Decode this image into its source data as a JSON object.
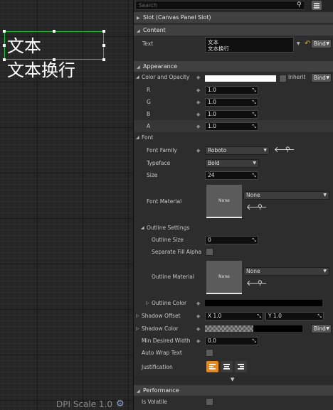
{
  "canvas": {
    "texts": [
      "文本",
      "文本换行"
    ],
    "dpi_scale": "DPI Scale 1.0"
  },
  "details": {
    "search_placeholder": "Search",
    "slot_header": "Slot (Canvas Panel Slot)",
    "sections": {
      "content": "Content",
      "appearance": "Appearance",
      "font": "Font",
      "outline_settings": "Outline Settings",
      "performance": "Performance"
    },
    "labels": {
      "text": "Text",
      "color_and_opacity": "Color and Opacity",
      "r": "R",
      "g": "G",
      "b": "B",
      "a": "A",
      "font_family": "Font Family",
      "typeface": "Typeface",
      "size": "Size",
      "font_material": "Font Material",
      "outline_size": "Outline Size",
      "separate_fill_alpha": "Separate Fill Alpha",
      "outline_material": "Outline Material",
      "outline_color": "Outline Color",
      "shadow_offset": "Shadow Offset",
      "shadow_color": "Shadow Color",
      "min_desired_width": "Min Desired Width",
      "auto_wrap_text": "Auto Wrap Text",
      "justification": "Justification",
      "is_volatile": "Is Volatile"
    },
    "values": {
      "text_line1": "文本",
      "text_line2": "文本换行",
      "inherit": "Inherit",
      "r": "1.0",
      "g": "1.0",
      "b": "1.0",
      "a": "1.0",
      "font_family": "Roboto",
      "typeface": "Bold",
      "size": "24",
      "none_thumb": "None",
      "font_material": "None",
      "outline_size": "0",
      "outline_material": "None",
      "shadow_x": "X  1.0",
      "shadow_y": "Y  1.0",
      "min_desired_width": "0.0"
    },
    "bind_label": "Bind",
    "colors": {
      "accent_orange": "#e5891f",
      "selection_green": "#1fbf3a",
      "color_and_opacity": "#ffffff",
      "outline_color": "#000000",
      "shadow_color": "#000000"
    },
    "icons": [
      "search-icon",
      "view-options-icon",
      "reset-icon",
      "use-selected-arrow-icon",
      "browse-icon",
      "gear-icon",
      "justify-left-icon",
      "justify-center-icon",
      "justify-right-icon"
    ]
  }
}
